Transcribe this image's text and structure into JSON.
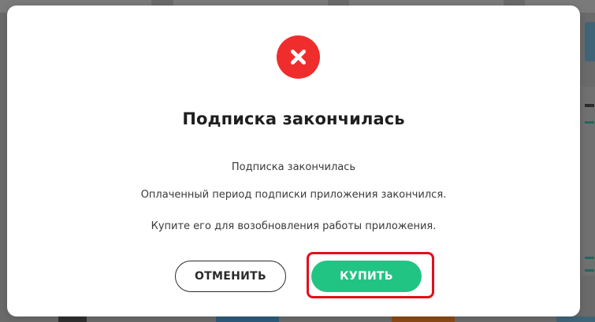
{
  "modal": {
    "icon": "close-icon",
    "title": "Подписка закончилась",
    "messages": [
      "Подписка закончилась",
      "Оплаченный период подписки приложения закончился.",
      "Купите его для возобновления работы приложения."
    ],
    "buttons": {
      "cancel_label": "ОТМЕНИТЬ",
      "buy_label": "КУПИТЬ"
    }
  },
  "colors": {
    "error": "#f02d2d",
    "primary": "#22c483",
    "highlight": "#e0101a",
    "overlay": "#6a6a6a"
  }
}
